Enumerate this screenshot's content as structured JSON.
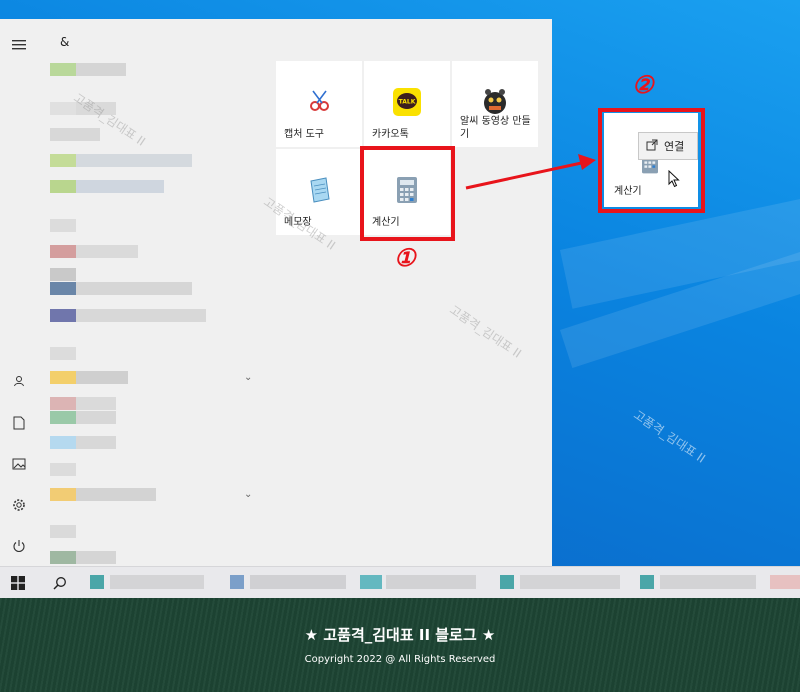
{
  "start_menu": {
    "section_letter": "&",
    "tiles": [
      {
        "label": "캡처 도구",
        "icon": "snipping-tool-icon"
      },
      {
        "label": "카카오톡",
        "icon": "kakaotalk-icon",
        "badge": "TALK"
      },
      {
        "label": "알씨 동영상 만들기",
        "icon": "alsee-video-maker-icon"
      },
      {
        "label": "메모장",
        "icon": "notepad-icon"
      },
      {
        "label": "계산기",
        "icon": "calculator-icon"
      }
    ]
  },
  "annotations": {
    "step1": "①",
    "step2": "②",
    "highlight_color": "#e8141b"
  },
  "desktop": {
    "pinned_tile_label": "계산기",
    "context_action": "연결"
  },
  "watermark": "고품격_김대표 II",
  "footer": {
    "title": "★ 고품격_김대표 II 블로그 ★",
    "copyright": "Copyright 2022 @ All Rights Reserved"
  },
  "colors": {
    "desktop_blue": "#0a84e0",
    "start_menu_bg": "#f0f0f0",
    "taskbar_bg": "#e9e9ec",
    "footer_green": "#1d4534"
  }
}
